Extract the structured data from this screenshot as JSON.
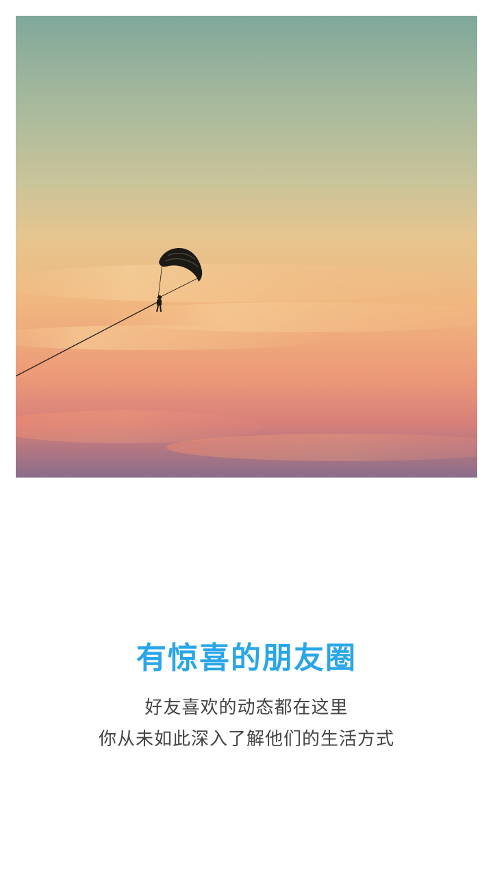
{
  "intro": {
    "title": "有惊喜的朋友圈",
    "subtitle_line1": "好友喜欢的动态都在这里",
    "subtitle_line2": "你从未如此深入了解他们的生活方式"
  },
  "colors": {
    "title": "#2aa6e8",
    "subtitle": "#444444",
    "background": "#ffffff"
  },
  "hero_image": {
    "subject": "parasailer silhouette against a sunset sky"
  }
}
